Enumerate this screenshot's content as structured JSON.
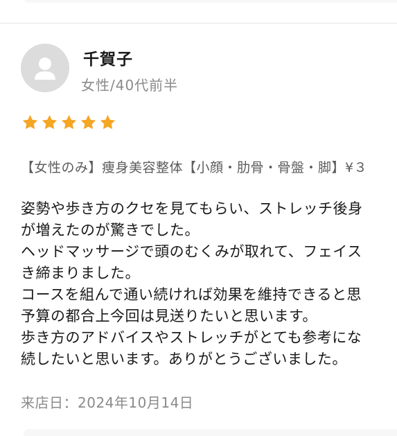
{
  "review": {
    "reviewer_name": "千賀子",
    "reviewer_meta": "女性/40代前半",
    "rating": 5,
    "star_color": "#f5a623",
    "course": "【女性のみ】痩身美容整体【小顔・肋骨・骨盤・脚】¥３",
    "body_lines": [
      "姿勢や歩き方のクセを見てもらい、ストレッチ後身",
      "が増えたのが驚きでした。",
      "ヘッドマッサージで頭のむくみが取れて、フェイス",
      "き締まりました。",
      "コースを組んで通い続ければ効果を維持できると思",
      "予算の都合上今回は見送りたいと思います。",
      "歩き方のアドバイスやストレッチがとても参考にな",
      "続したいと思います。ありがとうございました。"
    ],
    "visit_date": "来店日：2024年10月14日"
  },
  "icons": {
    "avatar": "user-avatar-icon",
    "star": "star-icon"
  }
}
